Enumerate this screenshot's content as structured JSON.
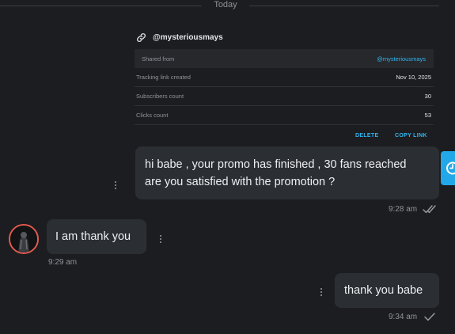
{
  "date_divider": "Today",
  "link_card": {
    "handle": "@mysteriousmays",
    "shared_from_label": "Shared from",
    "shared_from_value": "@mysteriousmays",
    "rows": [
      {
        "label": "Tracking link created",
        "value": "Nov 10, 2025"
      },
      {
        "label": "Subscribers count",
        "value": "30"
      },
      {
        "label": "Clicks count",
        "value": "53"
      }
    ],
    "delete_label": "DELETE",
    "copy_link_label": "COPY LINK"
  },
  "messages": [
    {
      "direction": "outgoing",
      "lines": [
        "hi babe , your promo has finished , 30 fans reached",
        "are you satisfied with the promotion ?"
      ],
      "time": "9:28 am",
      "status_icon": "double-check-icon"
    },
    {
      "direction": "incoming",
      "lines": [
        "I am thank you"
      ],
      "time": "9:29 am"
    },
    {
      "direction": "outgoing",
      "lines": [
        "thank you babe"
      ],
      "time": "9:34 am",
      "status_icon": "single-check-icon"
    }
  ],
  "colors": {
    "background": "#1c1d20",
    "bubble": "#2b2e32",
    "accent": "#2fb6f2",
    "avatar_ring": "#e55a4f"
  }
}
